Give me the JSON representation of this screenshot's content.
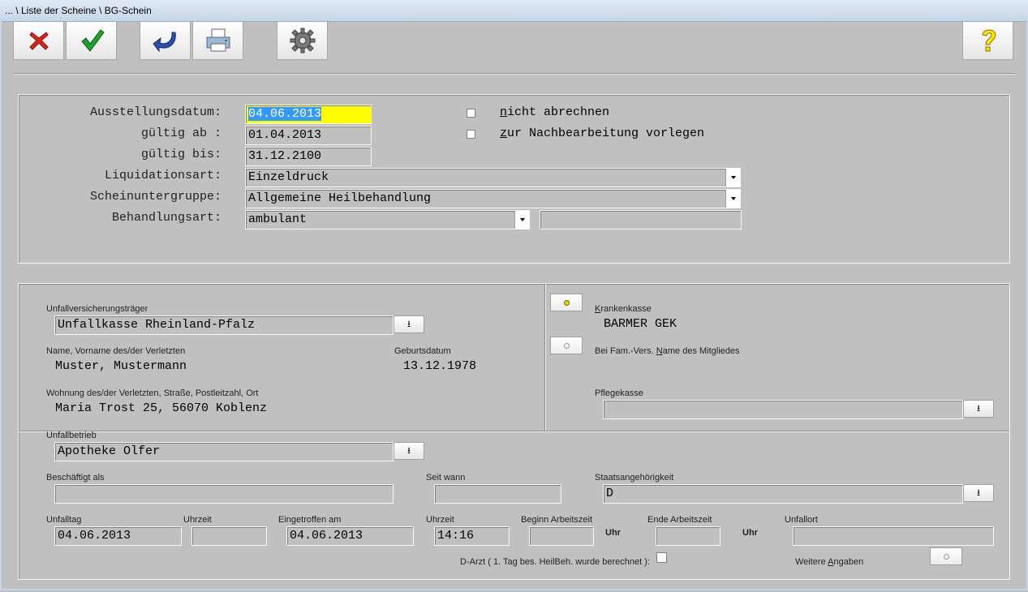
{
  "window": {
    "title": "... \\ Liste der Scheine \\ BG-Schein"
  },
  "toolbar": {
    "buttons": [
      {
        "name": "cancel",
        "icon": "red-x-icon"
      },
      {
        "name": "confirm",
        "icon": "green-check-icon"
      },
      {
        "name": "back",
        "icon": "back-arrow-icon"
      },
      {
        "name": "print",
        "icon": "printer-icon"
      },
      {
        "name": "settings",
        "icon": "gear-icon"
      },
      {
        "name": "help",
        "icon": "help-question-icon"
      }
    ]
  },
  "header": {
    "ausstellungsdatum_label": "Ausstellungsdatum:",
    "ausstellungsdatum_value": "04.06.2013",
    "gueltig_ab_label": "gültig ab :",
    "gueltig_ab_value": "01.04.2013",
    "gueltig_bis_label": "gültig bis:",
    "gueltig_bis_value": "31.12.2100",
    "liquidationsart_label": "Liquidationsart:",
    "liquidationsart_value": "Einzeldruck",
    "scheinuntergruppe_label": "Scheinuntergruppe:",
    "scheinuntergruppe_value": "Allgemeine Heilbehandlung",
    "behandlungsart_label": "Behandlungsart:",
    "behandlungsart_value": "ambulant",
    "behandlungsart_extra": "",
    "nicht_abrechnen_u": "n",
    "nicht_abrechnen_rest": "icht abrechnen",
    "nachbearbeitung_u": "z",
    "nachbearbeitung_rest": "ur Nachbearbeitung vorlegen"
  },
  "details": {
    "unfallversicherungstraeger_label": "Unfallversicherungsträger",
    "unfallversicherungstraeger_value": "Unfallkasse Rheinland-Pfalz",
    "name_label": "Name, Vorname des/der Verletzten",
    "name_value": "Muster, Mustermann",
    "geburtsdatum_label": "Geburtsdatum",
    "geburtsdatum_value": "13.12.1978",
    "wohnung_label": "Wohnung des/der Verletzten, Straße, Postleitzahl, Ort",
    "wohnung_value": "Maria Trost 25, 56070 Koblenz",
    "krankenkasse_u": "K",
    "krankenkasse_rest": "rankenkasse",
    "krankenkasse_value": "BARMER GEK",
    "famvers_pre": "Bei Fam.-Vers. ",
    "famvers_u": "N",
    "famvers_rest": "ame des Mitgliedes",
    "pflegekasse_label": "Pflegekasse",
    "pflegekasse_value": "",
    "unfallbetrieb_label": "Unfallbetrieb",
    "unfallbetrieb_value": "Apotheke Olfer",
    "beschaeftigt_label": "Beschäftigt als",
    "beschaeftigt_value": "",
    "seit_wann_label": "Seit wann",
    "seit_wann_value": "",
    "staatsangehoerigkeit_label": "Staatsangehörigkeit",
    "staatsangehoerigkeit_value": "D",
    "unfalltag_label": "Unfalltag",
    "unfalltag_value": "04.06.2013",
    "uhrzeit1_label": "Uhrzeit",
    "uhrzeit1_value": "",
    "eingetroffen_label": "Eingetroffen am",
    "eingetroffen_value": "04.06.2013",
    "uhrzeit2_label": "Uhrzeit",
    "uhrzeit2_value": "14:16",
    "beginn_label": "Beginn Arbeitszeit",
    "beginn_value": "",
    "uhr1": "Uhr",
    "ende_label": "Ende Arbeitszeit",
    "ende_value": "",
    "uhr2": "Uhr",
    "unfallort_label": "Unfallort",
    "unfallort_value": "",
    "darzt_label": "D-Arzt ( 1. Tag bes. HeilBeh. wurde berechnet ):",
    "weitere_pre": "Weitere ",
    "weitere_u": "A",
    "weitere_rest": "ngaben"
  },
  "colors": {
    "background": "#c0c0c0",
    "highlight": "#ffff00",
    "selection": "#3399ff"
  }
}
